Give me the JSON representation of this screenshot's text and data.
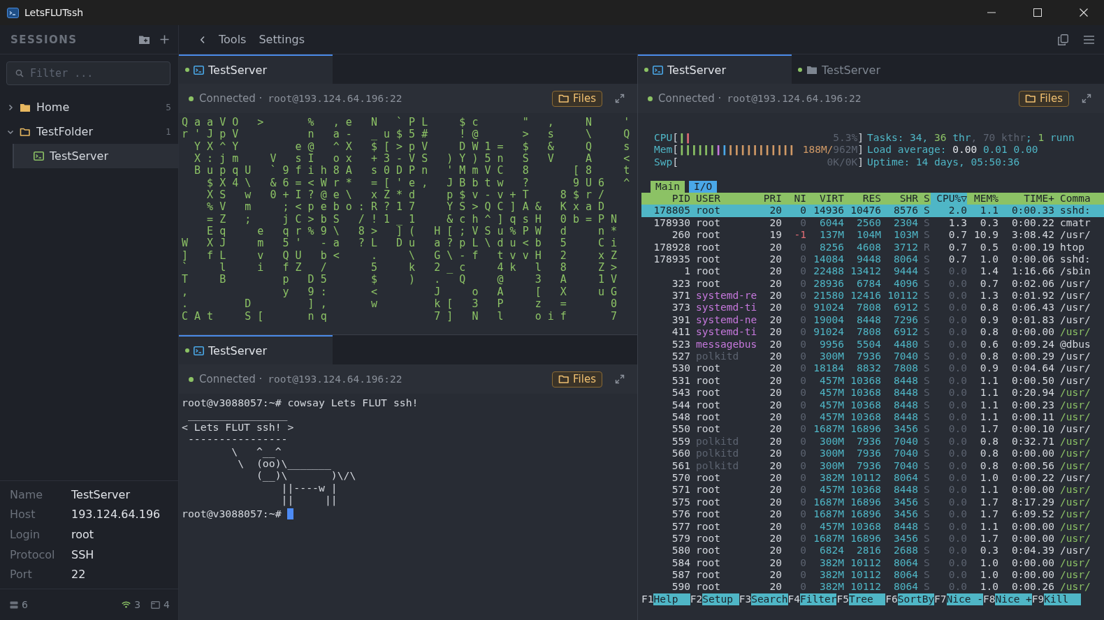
{
  "window": {
    "title": "LetsFLUTssh"
  },
  "sidebar": {
    "title": "SESSIONS",
    "filter": {
      "placeholder": "Filter ..."
    },
    "tree": [
      {
        "label": "Home",
        "kind": "folder",
        "count": "5",
        "expanded": false,
        "selected": false
      },
      {
        "label": "TestFolder",
        "kind": "folder",
        "count": "1",
        "expanded": true,
        "selected": false,
        "children": [
          {
            "label": "TestServer",
            "kind": "server",
            "selected": true
          }
        ]
      }
    ],
    "details": [
      {
        "label": "Name",
        "value": "TestServer"
      },
      {
        "label": "Host",
        "value": "193.124.64.196"
      },
      {
        "label": "Login",
        "value": "root"
      },
      {
        "label": "Protocol",
        "value": "SSH"
      },
      {
        "label": "Port",
        "value": "22"
      }
    ],
    "status": {
      "sessions": "6",
      "connections": "3",
      "windows": "4"
    }
  },
  "toolbar": {
    "items": [
      "Tools",
      "Settings"
    ]
  },
  "panes": [
    {
      "tabs": [
        {
          "label": "TestServer",
          "kind": "terminal",
          "connected": true,
          "selected": true
        }
      ],
      "status": {
        "connected": true,
        "text": "Connected ·",
        "address": "root@193.124.64.196:22"
      },
      "files_button": "Files",
      "terminal": {
        "kind": "matrix",
        "lines": [
          "Q a a V O   >       %   , e   N   ` P L     $ c       \"   ,     N     '",
          "r ' J p V           n   a -   _ u $ 5 #     ! @       >   s     \\     Q",
          "  Y X ^ Y         e @   ^ X   $ [ > p V     D W 1 =   $   &     Q     s",
          "  X : j m     V   s I   o x   + 3 - V S   ) Y ) 5 n   S   V     A     <",
          "  B u p q U   ` 9 f i h 8 A   s 0 D P n   ' M m V C   8       [ 8     t",
          "    $ X 4 \\   & 6 = < W r *   = [ ' e ,   J B b t w   ?       9 U 6   ^",
          "    X S   w   0 + I ? @ e \\   x Z * d     p $ v - v + T     8 $ r /",
          "    % V   m     ; < p e b o : R ? 1 7     Y S > Q C ] A &   K x a D",
          "    = Z   ;     j C > b S   / ! 1 _ 1     & c h ^ ] q s H   0 b = P N",
          "    E q     e   q r % 9 \\   8 >   ] (   H [ ; V S u % P W   d     n *",
          "W   X J     m   5 '   - a   ? L   D u   a ? p L \\ d u < b   5     C i",
          "]   f L     v   Q U   b <     .     \\   G \\ - f   t v v H   2     x Z",
          "`     l     i   f Z   /       5     k   2 _ c     4 k   l   8     Z >",
          "T     B         p   D 5       $     )   .   Q     @     3   A     1 V",
          ",               y   9 :       <         J     o   A     [   X     u G",
          ".         D         ] ,       w         k [   3   P     z   =       0",
          "C A t     S [       n q                 7 ]   N   l     o i f       7"
        ]
      }
    },
    {
      "tabs": [
        {
          "label": "TestServer",
          "kind": "terminal",
          "connected": true,
          "selected": true
        }
      ],
      "status": {
        "connected": true,
        "text": "Connected ·",
        "address": "root@193.124.64.196:22"
      },
      "files_button": "Files",
      "terminal": {
        "kind": "shell",
        "lines": [
          "root@v3088057:~# cowsay Lets FLUT ssh!",
          " ________________",
          "< Lets FLUT ssh! >",
          " ----------------",
          "        \\   ^__^",
          "         \\  (oo)\\_______",
          "            (__)\\       )\\/\\",
          "                ||----w |",
          "                ||     ||"
        ],
        "prompt": "root@v3088057:~# "
      }
    },
    {
      "tabs": [
        {
          "label": "TestServer",
          "kind": "terminal",
          "connected": true,
          "selected": true
        },
        {
          "label": "TestServer",
          "kind": "files",
          "connected": true,
          "selected": false
        }
      ],
      "status": {
        "connected": true,
        "text": "Connected ·",
        "address": "root@193.124.64.196:22"
      },
      "files_button": "Files",
      "terminal": {
        "kind": "htop",
        "meters": [
          {
            "label": "CPU",
            "open": "[",
            "bars": [
              {
                "text": "|",
                "color": "#8cc265"
              },
              {
                "text": "|",
                "color": "#e06c75"
              }
            ],
            "reading": [
              {
                "text": "5.3%",
                "color": "#5c6370"
              }
            ],
            "close": "]"
          },
          {
            "label": "Mem",
            "open": "[",
            "bars": [
              {
                "text": "||||||",
                "color": "#8cc265"
              },
              {
                "text": "|",
                "color": "#c678dd"
              },
              {
                "text": "|",
                "color": "#4aa8e8"
              },
              {
                "text": "|||||||||||",
                "color": "#d19a66"
              }
            ],
            "reading": [
              {
                "text": "188M/",
                "color": "#d19a66"
              },
              {
                "text": "962M",
                "color": "#5c6370"
              }
            ],
            "close": "]"
          },
          {
            "label": "Swp",
            "open": "[",
            "reading": [
              {
                "text": "0K/0K",
                "color": "#5c6370"
              }
            ],
            "close": "]"
          }
        ],
        "info": [
          [
            {
              "text": "Tasks: ",
              "color": "#4fb6c6"
            },
            {
              "text": "34, ",
              "color": "#4fb6c6"
            },
            {
              "text": "36",
              "color": "#8cc265"
            },
            {
              "text": " thr",
              "color": "#4fb6c6"
            },
            {
              "text": ", 70 kthr",
              "color": "#5c6370"
            },
            {
              "text": "; ",
              "color": "#4fb6c6"
            },
            {
              "text": "1",
              "color": "#8cc265"
            },
            {
              "text": " runn",
              "color": "#4fb6c6"
            }
          ],
          [
            {
              "text": "Load average: ",
              "color": "#4fb6c6"
            },
            {
              "text": "0.00 ",
              "color": "#e6e9ee"
            },
            {
              "text": "0.01 ",
              "color": "#4fb6c6"
            },
            {
              "text": "0.00",
              "color": "#4fb6c6"
            }
          ],
          [
            {
              "text": "Uptime: ",
              "color": "#4fb6c6"
            },
            {
              "text": "14 days, 05:50:36",
              "color": "#4fb6c6"
            }
          ]
        ],
        "tabs": [
          {
            "label": "Main",
            "selected": true
          },
          {
            "label": "I/O",
            "selected": false
          }
        ],
        "columns": [
          {
            "label": "PID",
            "sorted": false
          },
          {
            "label": "USER",
            "sorted": false
          },
          {
            "label": "PRI",
            "sorted": false
          },
          {
            "label": "NI",
            "sorted": false
          },
          {
            "label": "VIRT",
            "sorted": false
          },
          {
            "label": "RES",
            "sorted": false
          },
          {
            "label": "SHR",
            "sorted": false
          },
          {
            "label": "S",
            "sorted": false
          },
          {
            "label": "CPU%▽",
            "sorted": true
          },
          {
            "label": "MEM%",
            "sorted": false
          },
          {
            "label": "TIME+",
            "sorted": false
          },
          {
            "label": "Comma",
            "sorted": false
          }
        ],
        "rows": [
          {
            "cells": [
              "178805",
              "root",
              "20",
              "0",
              "14936",
              "10476",
              "8576",
              "S",
              "2.0",
              "1.1",
              "0:00.33",
              "sshd:"
            ],
            "selected": true
          },
          {
            "cells": [
              "178930",
              "root",
              "20",
              "0",
              "6044",
              "2560",
              "2304",
              "S",
              "1.3",
              "0.3",
              "0:00.22",
              "cmatr"
            ],
            "color": "#d4d8de",
            "selected": false,
            "thread": false
          },
          {
            "cells": [
              "260",
              "root",
              "19",
              "-1",
              "137M",
              "104M",
              "103M",
              "S",
              "0.7",
              "10.9",
              "3:08.42",
              "/usr/"
            ],
            "color": "#d4d8de",
            "selected": false,
            "thread": false
          },
          {
            "cells": [
              "178928",
              "root",
              "20",
              "0",
              "8256",
              "4608",
              "3712",
              "R",
              "0.7",
              "0.5",
              "0:00.19",
              "htop"
            ],
            "color": "#d4d8de",
            "selected": false,
            "thread": false
          },
          {
            "cells": [
              "178935",
              "root",
              "20",
              "0",
              "14084",
              "9448",
              "8064",
              "S",
              "0.7",
              "1.0",
              "0:00.06",
              "sshd:"
            ],
            "color": "#d4d8de",
            "selected": false,
            "thread": false
          },
          {
            "cells": [
              "1",
              "root",
              "20",
              "0",
              "22488",
              "13412",
              "9444",
              "S",
              "0.0",
              "1.4",
              "1:16.66",
              "/sbin"
            ],
            "color": "#d4d8de",
            "selected": false,
            "thread": false
          },
          {
            "cells": [
              "323",
              "root",
              "20",
              "0",
              "28936",
              "6784",
              "4096",
              "S",
              "0.0",
              "0.7",
              "0:02.06",
              "/usr/"
            ],
            "color": "#d4d8de",
            "selected": false,
            "thread": false
          },
          {
            "cells": [
              "371",
              "systemd-re",
              "20",
              "0",
              "21580",
              "12416",
              "10112",
              "S",
              "0.0",
              "1.3",
              "0:01.92",
              "/usr/"
            ],
            "color": "#c678dd",
            "selected": false,
            "thread": false
          },
          {
            "cells": [
              "373",
              "systemd-ti",
              "20",
              "0",
              "91024",
              "7808",
              "6912",
              "S",
              "0.0",
              "0.8",
              "0:06.43",
              "/usr/"
            ],
            "color": "#c678dd",
            "selected": false,
            "thread": false
          },
          {
            "cells": [
              "391",
              "systemd-ne",
              "20",
              "0",
              "19004",
              "8448",
              "7296",
              "S",
              "0.0",
              "0.9",
              "0:01.83",
              "/usr/"
            ],
            "color": "#c678dd",
            "selected": false,
            "thread": false
          },
          {
            "cells": [
              "411",
              "systemd-ti",
              "20",
              "0",
              "91024",
              "7808",
              "6912",
              "S",
              "0.0",
              "0.8",
              "0:00.00",
              "/usr/"
            ],
            "color": "#c678dd",
            "selected": false,
            "thread": true
          },
          {
            "cells": [
              "523",
              "messagebus",
              "20",
              "0",
              "9956",
              "5504",
              "4480",
              "S",
              "0.0",
              "0.6",
              "0:09.24",
              "@dbus"
            ],
            "color": "#c678dd",
            "selected": false,
            "thread": false
          },
          {
            "cells": [
              "527",
              "polkitd",
              "20",
              "0",
              "300M",
              "7936",
              "7040",
              "S",
              "0.0",
              "0.8",
              "0:00.29",
              "/usr/"
            ],
            "color": "#5c6370",
            "selected": false,
            "thread": false
          },
          {
            "cells": [
              "530",
              "root",
              "20",
              "0",
              "18184",
              "8832",
              "7808",
              "S",
              "0.0",
              "0.9",
              "0:04.64",
              "/usr/"
            ],
            "color": "#d4d8de",
            "selected": false,
            "thread": false
          },
          {
            "cells": [
              "531",
              "root",
              "20",
              "0",
              "457M",
              "10368",
              "8448",
              "S",
              "0.0",
              "1.1",
              "0:00.50",
              "/usr/"
            ],
            "color": "#d4d8de",
            "selected": false,
            "thread": false
          },
          {
            "cells": [
              "543",
              "root",
              "20",
              "0",
              "457M",
              "10368",
              "8448",
              "S",
              "0.0",
              "1.1",
              "0:20.94",
              "/usr/"
            ],
            "color": "#d4d8de",
            "selected": false,
            "thread": true
          },
          {
            "cells": [
              "544",
              "root",
              "20",
              "0",
              "457M",
              "10368",
              "8448",
              "S",
              "0.0",
              "1.1",
              "0:00.23",
              "/usr/"
            ],
            "color": "#d4d8de",
            "selected": false,
            "thread": true
          },
          {
            "cells": [
              "548",
              "root",
              "20",
              "0",
              "457M",
              "10368",
              "8448",
              "S",
              "0.0",
              "1.1",
              "0:00.11",
              "/usr/"
            ],
            "color": "#d4d8de",
            "selected": false,
            "thread": true
          },
          {
            "cells": [
              "550",
              "root",
              "20",
              "0",
              "1687M",
              "16896",
              "3456",
              "S",
              "0.0",
              "1.7",
              "0:00.10",
              "/usr/"
            ],
            "color": "#d4d8de",
            "selected": false,
            "thread": false
          },
          {
            "cells": [
              "559",
              "polkitd",
              "20",
              "0",
              "300M",
              "7936",
              "7040",
              "S",
              "0.0",
              "0.8",
              "0:32.71",
              "/usr/"
            ],
            "color": "#5c6370",
            "selected": false,
            "thread": true
          },
          {
            "cells": [
              "560",
              "polkitd",
              "20",
              "0",
              "300M",
              "7936",
              "7040",
              "S",
              "0.0",
              "0.8",
              "0:00.00",
              "/usr/"
            ],
            "color": "#5c6370",
            "selected": false,
            "thread": true
          },
          {
            "cells": [
              "561",
              "polkitd",
              "20",
              "0",
              "300M",
              "7936",
              "7040",
              "S",
              "0.0",
              "0.8",
              "0:00.56",
              "/usr/"
            ],
            "color": "#5c6370",
            "selected": false,
            "thread": true
          },
          {
            "cells": [
              "570",
              "root",
              "20",
              "0",
              "382M",
              "10112",
              "8064",
              "S",
              "0.0",
              "1.0",
              "0:00.22",
              "/usr/"
            ],
            "color": "#d4d8de",
            "selected": false,
            "thread": false
          },
          {
            "cells": [
              "571",
              "root",
              "20",
              "0",
              "457M",
              "10368",
              "8448",
              "S",
              "0.0",
              "1.1",
              "0:00.00",
              "/usr/"
            ],
            "color": "#d4d8de",
            "selected": false,
            "thread": true
          },
          {
            "cells": [
              "575",
              "root",
              "20",
              "0",
              "1687M",
              "16896",
              "3456",
              "S",
              "0.0",
              "1.7",
              "8:17.29",
              "/usr/"
            ],
            "color": "#d4d8de",
            "selected": false,
            "thread": true
          },
          {
            "cells": [
              "576",
              "root",
              "20",
              "0",
              "1687M",
              "16896",
              "3456",
              "S",
              "0.0",
              "1.7",
              "6:09.52",
              "/usr/"
            ],
            "color": "#d4d8de",
            "selected": false,
            "thread": true
          },
          {
            "cells": [
              "577",
              "root",
              "20",
              "0",
              "457M",
              "10368",
              "8448",
              "S",
              "0.0",
              "1.1",
              "0:00.00",
              "/usr/"
            ],
            "color": "#d4d8de",
            "selected": false,
            "thread": true
          },
          {
            "cells": [
              "579",
              "root",
              "20",
              "0",
              "1687M",
              "16896",
              "3456",
              "S",
              "0.0",
              "1.7",
              "0:00.00",
              "/usr/"
            ],
            "color": "#d4d8de",
            "selected": false,
            "thread": true
          },
          {
            "cells": [
              "580",
              "root",
              "20",
              "0",
              "6824",
              "2816",
              "2688",
              "S",
              "0.0",
              "0.3",
              "0:04.39",
              "/usr/"
            ],
            "color": "#d4d8de",
            "selected": false,
            "thread": false
          },
          {
            "cells": [
              "584",
              "root",
              "20",
              "0",
              "382M",
              "10112",
              "8064",
              "S",
              "0.0",
              "1.0",
              "0:00.00",
              "/usr/"
            ],
            "color": "#d4d8de",
            "selected": false,
            "thread": true
          },
          {
            "cells": [
              "587",
              "root",
              "20",
              "0",
              "382M",
              "10112",
              "8064",
              "S",
              "0.0",
              "1.0",
              "0:00.00",
              "/usr/"
            ],
            "color": "#d4d8de",
            "selected": false,
            "thread": true
          },
          {
            "cells": [
              "590",
              "root",
              "20",
              "0",
              "382M",
              "10112",
              "8064",
              "S",
              "0.0",
              "1.0",
              "0:00.26",
              "/usr/"
            ],
            "color": "#d4d8de",
            "selected": false,
            "thread": true
          }
        ],
        "keys": [
          {
            "key": "F1",
            "label": "Help"
          },
          {
            "key": "F2",
            "label": "Setup"
          },
          {
            "key": "F3",
            "label": "Search"
          },
          {
            "key": "F4",
            "label": "Filter"
          },
          {
            "key": "F5",
            "label": "Tree"
          },
          {
            "key": "F6",
            "label": "SortBy"
          },
          {
            "key": "F7",
            "label": "Nice -"
          },
          {
            "key": "F8",
            "label": "Nice +"
          },
          {
            "key": "F9",
            "label": "Kill"
          }
        ]
      }
    }
  ]
}
